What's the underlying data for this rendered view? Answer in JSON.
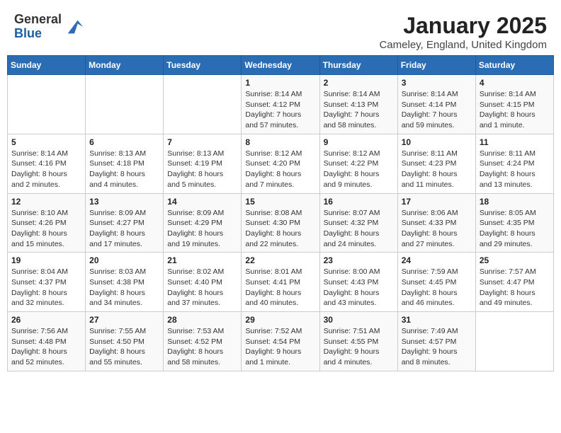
{
  "header": {
    "logo_general": "General",
    "logo_blue": "Blue",
    "month_title": "January 2025",
    "location": "Cameley, England, United Kingdom"
  },
  "weekdays": [
    "Sunday",
    "Monday",
    "Tuesday",
    "Wednesday",
    "Thursday",
    "Friday",
    "Saturday"
  ],
  "weeks": [
    [
      {
        "day": "",
        "info": ""
      },
      {
        "day": "",
        "info": ""
      },
      {
        "day": "",
        "info": ""
      },
      {
        "day": "1",
        "info": "Sunrise: 8:14 AM\nSunset: 4:12 PM\nDaylight: 7 hours and 57 minutes."
      },
      {
        "day": "2",
        "info": "Sunrise: 8:14 AM\nSunset: 4:13 PM\nDaylight: 7 hours and 58 minutes."
      },
      {
        "day": "3",
        "info": "Sunrise: 8:14 AM\nSunset: 4:14 PM\nDaylight: 7 hours and 59 minutes."
      },
      {
        "day": "4",
        "info": "Sunrise: 8:14 AM\nSunset: 4:15 PM\nDaylight: 8 hours and 1 minute."
      }
    ],
    [
      {
        "day": "5",
        "info": "Sunrise: 8:14 AM\nSunset: 4:16 PM\nDaylight: 8 hours and 2 minutes."
      },
      {
        "day": "6",
        "info": "Sunrise: 8:13 AM\nSunset: 4:18 PM\nDaylight: 8 hours and 4 minutes."
      },
      {
        "day": "7",
        "info": "Sunrise: 8:13 AM\nSunset: 4:19 PM\nDaylight: 8 hours and 5 minutes."
      },
      {
        "day": "8",
        "info": "Sunrise: 8:12 AM\nSunset: 4:20 PM\nDaylight: 8 hours and 7 minutes."
      },
      {
        "day": "9",
        "info": "Sunrise: 8:12 AM\nSunset: 4:22 PM\nDaylight: 8 hours and 9 minutes."
      },
      {
        "day": "10",
        "info": "Sunrise: 8:11 AM\nSunset: 4:23 PM\nDaylight: 8 hours and 11 minutes."
      },
      {
        "day": "11",
        "info": "Sunrise: 8:11 AM\nSunset: 4:24 PM\nDaylight: 8 hours and 13 minutes."
      }
    ],
    [
      {
        "day": "12",
        "info": "Sunrise: 8:10 AM\nSunset: 4:26 PM\nDaylight: 8 hours and 15 minutes."
      },
      {
        "day": "13",
        "info": "Sunrise: 8:09 AM\nSunset: 4:27 PM\nDaylight: 8 hours and 17 minutes."
      },
      {
        "day": "14",
        "info": "Sunrise: 8:09 AM\nSunset: 4:29 PM\nDaylight: 8 hours and 19 minutes."
      },
      {
        "day": "15",
        "info": "Sunrise: 8:08 AM\nSunset: 4:30 PM\nDaylight: 8 hours and 22 minutes."
      },
      {
        "day": "16",
        "info": "Sunrise: 8:07 AM\nSunset: 4:32 PM\nDaylight: 8 hours and 24 minutes."
      },
      {
        "day": "17",
        "info": "Sunrise: 8:06 AM\nSunset: 4:33 PM\nDaylight: 8 hours and 27 minutes."
      },
      {
        "day": "18",
        "info": "Sunrise: 8:05 AM\nSunset: 4:35 PM\nDaylight: 8 hours and 29 minutes."
      }
    ],
    [
      {
        "day": "19",
        "info": "Sunrise: 8:04 AM\nSunset: 4:37 PM\nDaylight: 8 hours and 32 minutes."
      },
      {
        "day": "20",
        "info": "Sunrise: 8:03 AM\nSunset: 4:38 PM\nDaylight: 8 hours and 34 minutes."
      },
      {
        "day": "21",
        "info": "Sunrise: 8:02 AM\nSunset: 4:40 PM\nDaylight: 8 hours and 37 minutes."
      },
      {
        "day": "22",
        "info": "Sunrise: 8:01 AM\nSunset: 4:41 PM\nDaylight: 8 hours and 40 minutes."
      },
      {
        "day": "23",
        "info": "Sunrise: 8:00 AM\nSunset: 4:43 PM\nDaylight: 8 hours and 43 minutes."
      },
      {
        "day": "24",
        "info": "Sunrise: 7:59 AM\nSunset: 4:45 PM\nDaylight: 8 hours and 46 minutes."
      },
      {
        "day": "25",
        "info": "Sunrise: 7:57 AM\nSunset: 4:47 PM\nDaylight: 8 hours and 49 minutes."
      }
    ],
    [
      {
        "day": "26",
        "info": "Sunrise: 7:56 AM\nSunset: 4:48 PM\nDaylight: 8 hours and 52 minutes."
      },
      {
        "day": "27",
        "info": "Sunrise: 7:55 AM\nSunset: 4:50 PM\nDaylight: 8 hours and 55 minutes."
      },
      {
        "day": "28",
        "info": "Sunrise: 7:53 AM\nSunset: 4:52 PM\nDaylight: 8 hours and 58 minutes."
      },
      {
        "day": "29",
        "info": "Sunrise: 7:52 AM\nSunset: 4:54 PM\nDaylight: 9 hours and 1 minute."
      },
      {
        "day": "30",
        "info": "Sunrise: 7:51 AM\nSunset: 4:55 PM\nDaylight: 9 hours and 4 minutes."
      },
      {
        "day": "31",
        "info": "Sunrise: 7:49 AM\nSunset: 4:57 PM\nDaylight: 9 hours and 8 minutes."
      },
      {
        "day": "",
        "info": ""
      }
    ]
  ]
}
